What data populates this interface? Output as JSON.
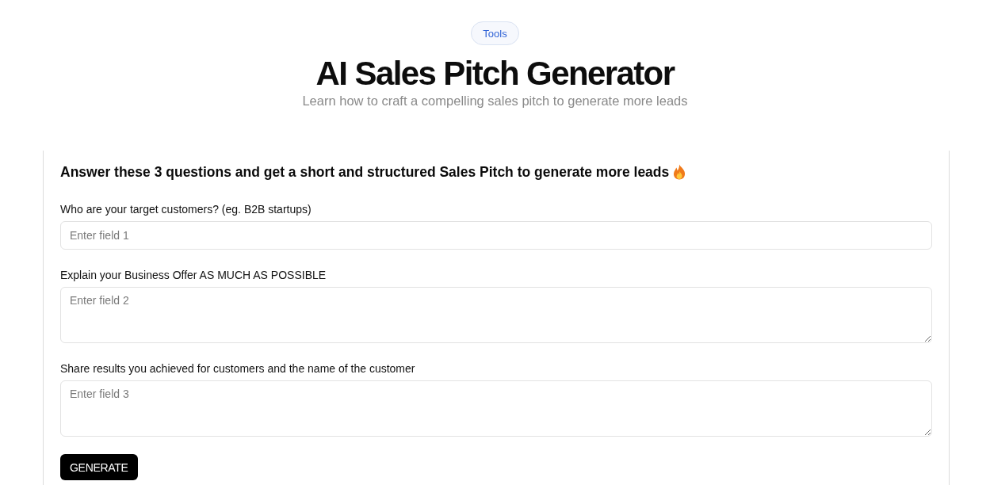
{
  "tag": {
    "label": "Tools"
  },
  "header": {
    "title": "AI Sales Pitch Generator",
    "subtitle": "Learn how to craft a compelling sales pitch to generate more leads"
  },
  "form": {
    "heading": "Answer these 3 questions and get a short and structured Sales Pitch to generate more leads",
    "fields": [
      {
        "kind": "input",
        "label": "Who are your target customers? (eg. B2B startups)",
        "placeholder": "Enter field 1"
      },
      {
        "kind": "textarea",
        "label": "Explain your Business Offer AS MUCH AS POSSIBLE",
        "placeholder": "Enter field 2"
      },
      {
        "kind": "textarea",
        "label": "Share results you achieved for customers and the name of the customer",
        "placeholder": "Enter field 3"
      }
    ],
    "button": "GENERATE"
  }
}
